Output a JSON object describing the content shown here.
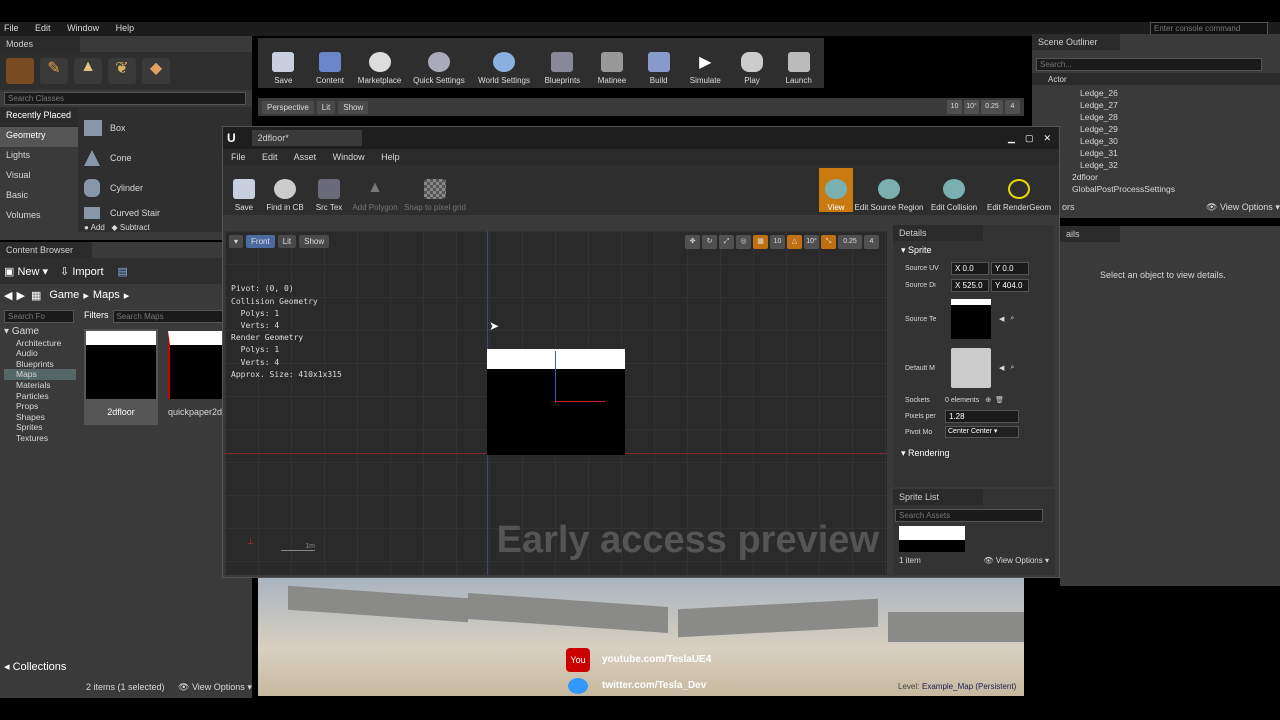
{
  "main_menu": [
    "File",
    "Edit",
    "Window",
    "Help"
  ],
  "console_placeholder": "Enter console command",
  "modes": {
    "tab": "Modes",
    "search": "Search Classes",
    "categories": [
      "Recently Placed",
      "Geometry",
      "Lights",
      "Visual",
      "Basic",
      "Volumes"
    ],
    "items": [
      "Box",
      "Cone",
      "Cylinder",
      "Curved Stair"
    ],
    "add": "Add",
    "subtract": "Subtract"
  },
  "toolbar": [
    "Save",
    "Content",
    "Marketplace",
    "Quick Settings",
    "World Settings",
    "Blueprints",
    "Matinee",
    "Build",
    "Simulate",
    "Play",
    "Launch"
  ],
  "level_viewport": {
    "perspective": "Perspective",
    "lit": "Lit",
    "show": "Show",
    "snap1": "10",
    "snap2": "10°",
    "snap3": "0.25",
    "snap4": "4"
  },
  "content_browser": {
    "tab": "Content Browser",
    "new": "New",
    "import": "Import",
    "path": [
      "Game",
      "Maps"
    ],
    "search_folders": "Search Fo",
    "filters": "Filters",
    "search_maps": "Search Maps",
    "tree": [
      "Game",
      "Architecture",
      "Audio",
      "Blueprints",
      "Maps",
      "Materials",
      "Particles",
      "Props",
      "Shapes",
      "Sprites",
      "Textures"
    ],
    "assets": [
      "2dfloor",
      "quickpaper2d"
    ],
    "collections": "Collections",
    "status": "2 items (1 selected)",
    "view_options": "View Options"
  },
  "scene_outliner": {
    "tab": "Scene Outliner",
    "search": "Search...",
    "column": "Actor",
    "items": [
      "Ledge_26",
      "Ledge_27",
      "Ledge_28",
      "Ledge_29",
      "Ledge_30",
      "Ledge_31",
      "Ledge_32",
      "2dfloor",
      "GlobalPostProcessSettings"
    ],
    "view_options": "View Options",
    "tab2": "ors"
  },
  "right_details": {
    "tab": "ails",
    "message": "Select an object to view details."
  },
  "sprite_editor": {
    "tab": "2dfloor*",
    "menu": [
      "File",
      "Edit",
      "Asset",
      "Window",
      "Help"
    ],
    "tools": [
      "Save",
      "Find in CB",
      "Src Tex",
      "Add Polygon",
      "Snap to pixel grid"
    ],
    "modes": [
      "View",
      "Edit Source Region",
      "Edit Collision",
      "Edit RenderGeom"
    ],
    "viewport": {
      "front": "Front",
      "lit": "Lit",
      "show": "Show",
      "snap1": "10",
      "snap2": "10°",
      "snap3": "0.25",
      "snap4": "4",
      "scale": "1m",
      "watermark": "Early access preview"
    },
    "info": [
      "Pivot: (0, 0)",
      "Collision Geometry",
      "  Polys: 1",
      "  Verts: 4",
      "Render Geometry",
      "  Polys: 1",
      "  Verts: 4",
      "Approx. Size: 410x1x315"
    ],
    "details": {
      "tab": "Details",
      "section": "Sprite",
      "src_uv": "Source UV",
      "src_uv_x": "X 0.0",
      "src_uv_y": "Y 0.0",
      "src_dim": "Source Di",
      "src_dim_x": "X 525.0",
      "src_dim_y": "Y 404.0",
      "src_tex": "Source Te",
      "default_mat": "Default M",
      "sockets": "Sockets",
      "sockets_val": "0 elements",
      "pixels": "Pixels per",
      "pixels_val": "1.28",
      "pivot": "Pivot Mo",
      "pivot_val": "Center Center",
      "rendering": "Rendering"
    },
    "sprite_list": {
      "tab": "Sprite List",
      "search": "Search Assets",
      "count": "1 item",
      "view_options": "View Options"
    }
  },
  "overlay": {
    "youtube": "youtube.com/TeslaUE4",
    "twitter": "twitter.com/Tesla_Dev",
    "level": "Level:",
    "level_name": "Example_Map (Persistent)"
  }
}
